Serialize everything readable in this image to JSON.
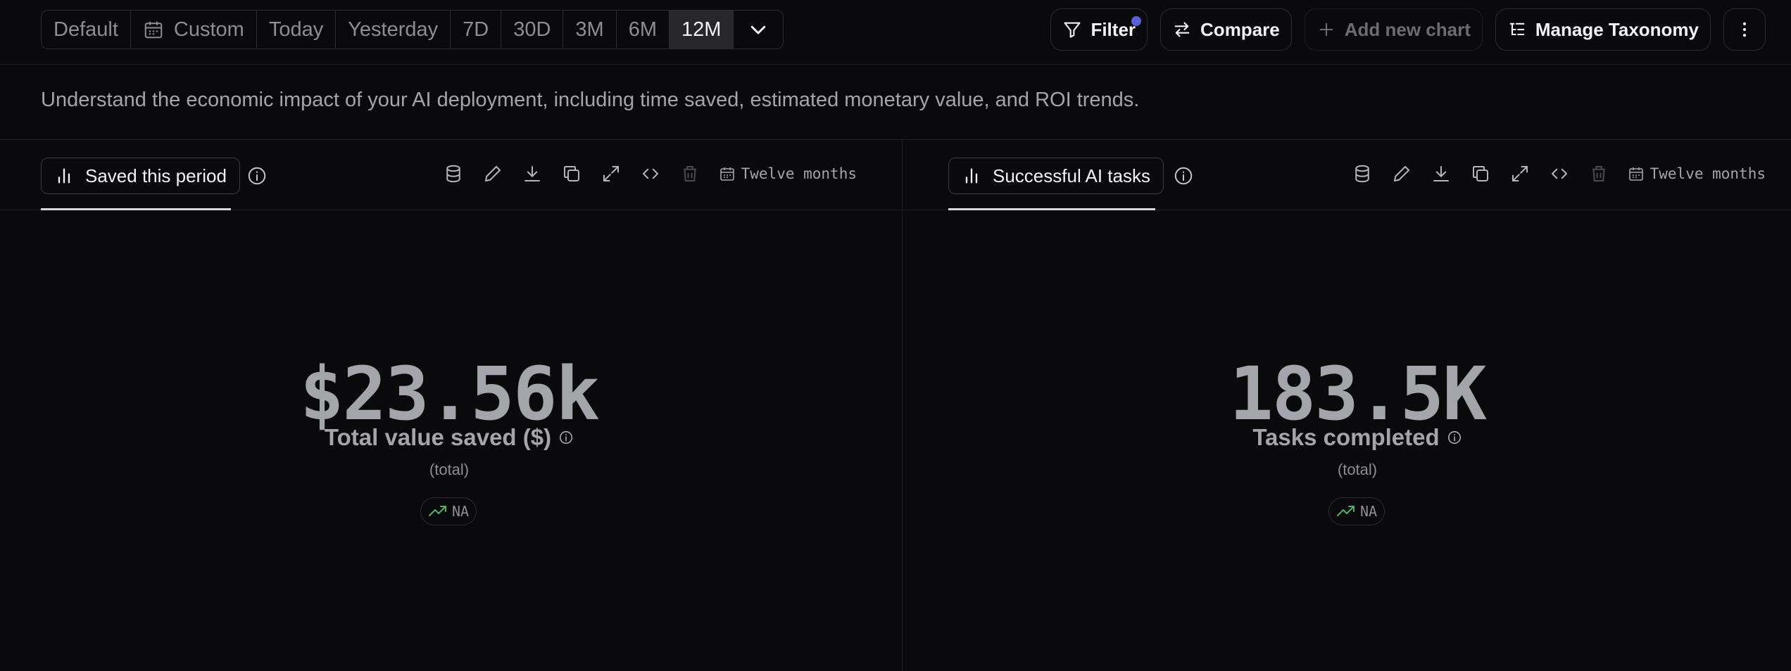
{
  "range_buttons": [
    {
      "label": "Default"
    },
    {
      "label": "Custom",
      "icon": "calendar-icon"
    },
    {
      "label": "Today"
    },
    {
      "label": "Yesterday"
    },
    {
      "label": "7D"
    },
    {
      "label": "30D"
    },
    {
      "label": "3M"
    },
    {
      "label": "6M"
    },
    {
      "label": "12M",
      "active": true
    }
  ],
  "actions": {
    "filter_label": "Filter",
    "compare_label": "Compare",
    "add_chart_label": "Add new chart",
    "manage_taxonomy_label": "Manage Taxonomy"
  },
  "description": "Understand the economic impact of your AI deployment, including time saved, estimated monetary value, and ROI trends.",
  "panels": {
    "left": {
      "tab_label": "Saved this period",
      "range_label": "Twelve months",
      "value": "$23.56k",
      "metric_label": "Total value saved ($)",
      "sub_label": "(total)",
      "trend": "NA"
    },
    "right": {
      "tab_label": "Successful AI tasks",
      "range_label": "Twelve months",
      "value": "183.5K",
      "metric_label": "Tasks completed",
      "sub_label": "(total)",
      "trend": "NA"
    }
  },
  "colors": {
    "accent_dot": "#5b5fd6",
    "trend_green": "#4fb26a",
    "background": "#0a0a0c"
  }
}
